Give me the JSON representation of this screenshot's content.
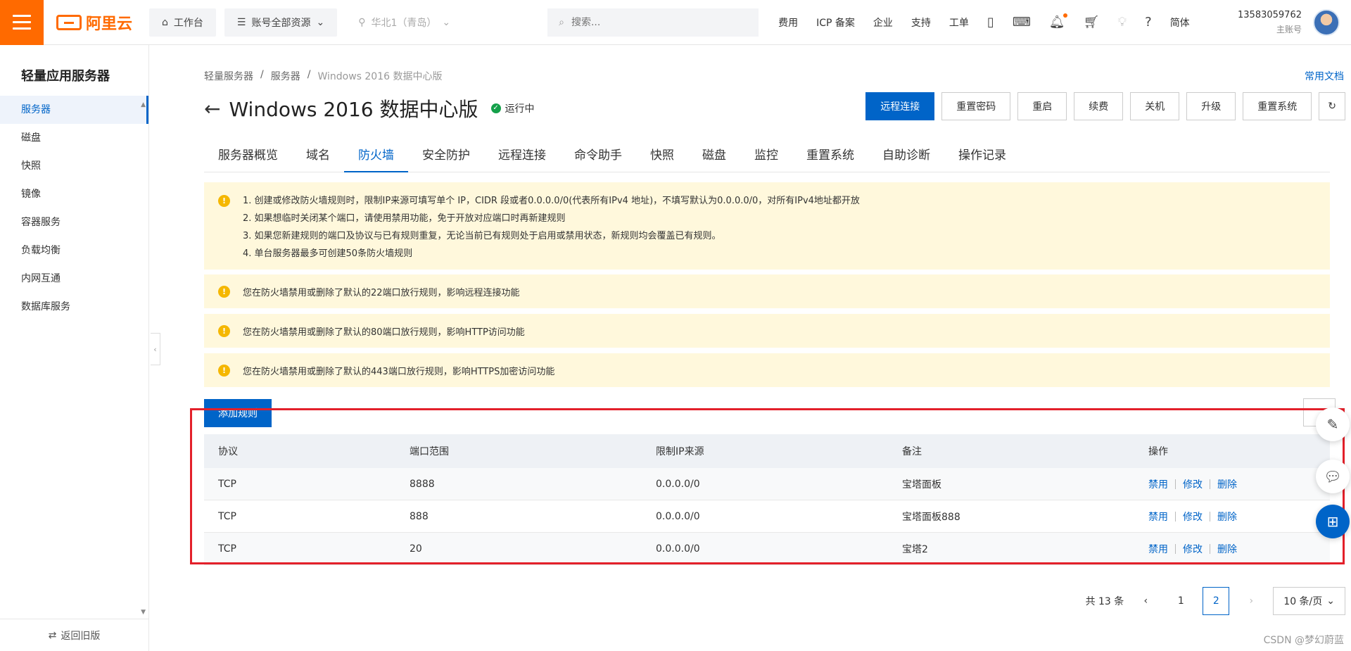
{
  "header": {
    "logo_text": "阿里云",
    "workbench": "工作台",
    "resources": "账号全部资源",
    "region": "华北1（青岛）",
    "search_placeholder": "搜索...",
    "nav": [
      "费用",
      "ICP 备案",
      "企业",
      "支持",
      "工单"
    ],
    "lang": "简体",
    "account_id": "13583059762",
    "account_type": "主账号"
  },
  "sidebar": {
    "title": "轻量应用服务器",
    "items": [
      "服务器",
      "磁盘",
      "快照",
      "镜像",
      "容器服务",
      "负载均衡",
      "内网互通",
      "数据库服务"
    ],
    "active_index": 0,
    "footer": "返回旧版"
  },
  "breadcrumb": [
    "轻量服务器",
    "服务器",
    "Windows 2016 数据中心版"
  ],
  "doc_link": "常用文档",
  "page_title": "Windows 2016 数据中心版",
  "status": "运行中",
  "actions": [
    "远程连接",
    "重置密码",
    "重启",
    "续费",
    "关机",
    "升级",
    "重置系统"
  ],
  "tabs": [
    "服务器概览",
    "域名",
    "防火墙",
    "安全防护",
    "远程连接",
    "命令助手",
    "快照",
    "磁盘",
    "监控",
    "重置系统",
    "自助诊断",
    "操作记录"
  ],
  "active_tab": "防火墙",
  "notices": {
    "rules": [
      "1. 创建或修改防火墙规则时，限制IP来源可填写单个 IP，CIDR 段或者0.0.0.0/0(代表所有IPv4 地址)，不填写默认为0.0.0.0/0，对所有IPv4地址都开放",
      "2. 如果想临时关闭某个端口，请使用禁用功能，免于开放对应端口时再新建规则",
      "3. 如果您新建规则的端口及协议与已有规则重复，无论当前已有规则处于启用或禁用状态，新规则均会覆盖已有规则。",
      "4. 单台服务器最多可创建50条防火墙规则"
    ],
    "port22": "您在防火墙禁用或删除了默认的22端口放行规则，影响远程连接功能",
    "port80": "您在防火墙禁用或删除了默认的80端口放行规则，影响HTTP访问功能",
    "port443": "您在防火墙禁用或删除了默认的443端口放行规则，影响HTTPS加密访问功能"
  },
  "add_rule": "添加规则",
  "table": {
    "headers": [
      "协议",
      "端口范围",
      "限制IP来源",
      "备注",
      "操作"
    ],
    "rows": [
      {
        "protocol": "TCP",
        "port": "8888",
        "source": "0.0.0.0/0",
        "note": "宝塔面板"
      },
      {
        "protocol": "TCP",
        "port": "888",
        "source": "0.0.0.0/0",
        "note": "宝塔面板888"
      },
      {
        "protocol": "TCP",
        "port": "20",
        "source": "0.0.0.0/0",
        "note": "宝塔2"
      }
    ],
    "row_actions": [
      "禁用",
      "修改",
      "删除"
    ]
  },
  "pagination": {
    "total": "共 13 条",
    "pages": [
      "1",
      "2"
    ],
    "current": "2",
    "page_size": "10 条/页"
  },
  "watermark": "CSDN @梦幻蔚蓝"
}
